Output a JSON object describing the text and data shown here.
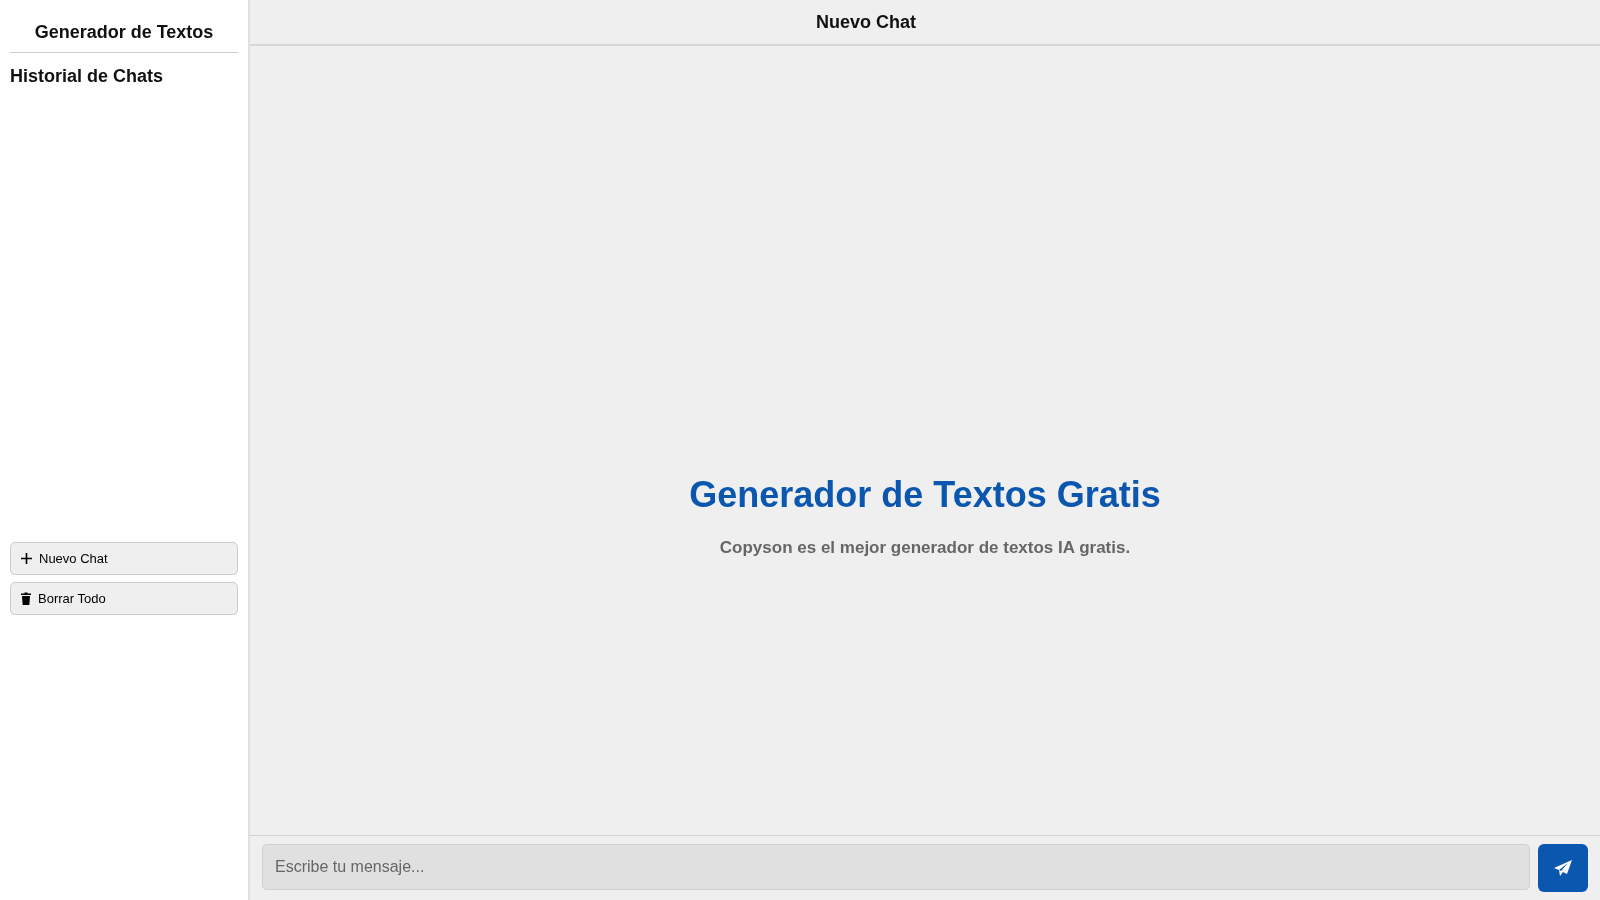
{
  "sidebar": {
    "title": "Generador de Textos",
    "history_heading": "Historial de Chats",
    "buttons": [
      {
        "kind": "add",
        "label": "Nuevo Chat"
      },
      {
        "kind": "delete",
        "label": "Borrar Todo"
      }
    ]
  },
  "header": {
    "title": "Nuevo Chat"
  },
  "hero": {
    "title": "Generador de Textos Gratis",
    "subtitle": "Copyson es el mejor generador de textos IA gratis."
  },
  "composer": {
    "placeholder": "Escribe tu mensaje..."
  }
}
